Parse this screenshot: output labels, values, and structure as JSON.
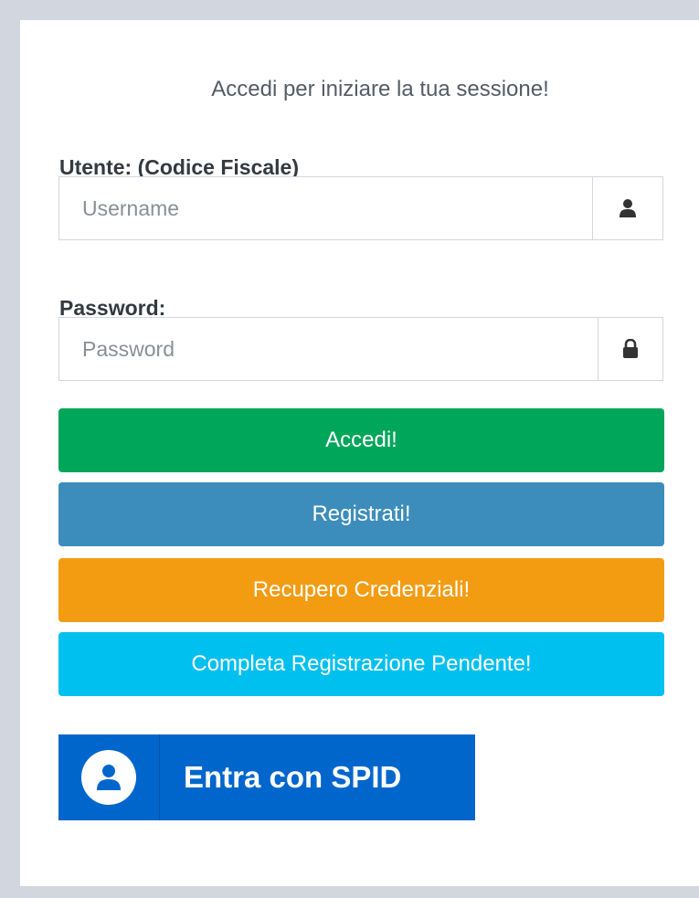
{
  "login": {
    "subtitle": "Accedi per iniziare la tua sessione!",
    "username_label": "Utente: (Codice Fiscale)",
    "username_placeholder": "Username",
    "password_label": "Password:",
    "password_placeholder": "Password"
  },
  "buttons": {
    "accedi": "Accedi!",
    "registrati": "Registrati!",
    "recupero": "Recupero Credenziali!",
    "completa": "Completa Registrazione Pendente!"
  },
  "spid": {
    "label": "Entra con SPID"
  },
  "icons": {
    "username_addon": "user-icon",
    "password_addon": "lock-icon",
    "spid": "spid-user-icon"
  },
  "colors": {
    "accedi": "#00a65a",
    "registrati": "#3c8dbc",
    "recupero": "#f39c12",
    "completa": "#00c0ef",
    "spid": "#0066cc"
  }
}
